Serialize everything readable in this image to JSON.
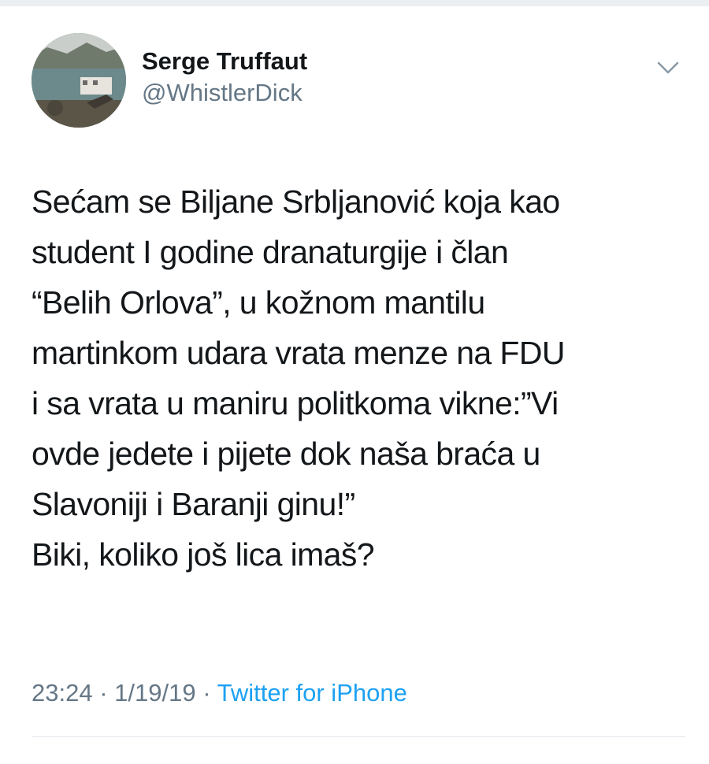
{
  "tweet": {
    "author": {
      "display_name": "Serge Truffaut",
      "handle": "@WhistlerDick",
      "avatar_icon": "avatar-photo"
    },
    "menu_icon": "chevron-down-icon",
    "text_lines": [
      "Sećam se Biljane Srbljanović koja kao",
      "student I godine dranaturgije i član",
      "“Belih Orlova”, u kožnom mantilu",
      "martinkom udara vrata menze na FDU",
      "i sa vrata u maniru politkoma vikne:”Vi",
      "ovde jedete i pijete dok naša braća u",
      "Slavoniji i Baranji ginu!”",
      "Biki, koliko još lica imaš?"
    ],
    "meta": {
      "time": "23:24",
      "separator": "·",
      "date": "1/19/19",
      "source": "Twitter for iPhone"
    }
  },
  "colors": {
    "text": "#14171a",
    "secondary": "#657786",
    "link": "#1da1f2",
    "divider": "#e1e8ed"
  }
}
